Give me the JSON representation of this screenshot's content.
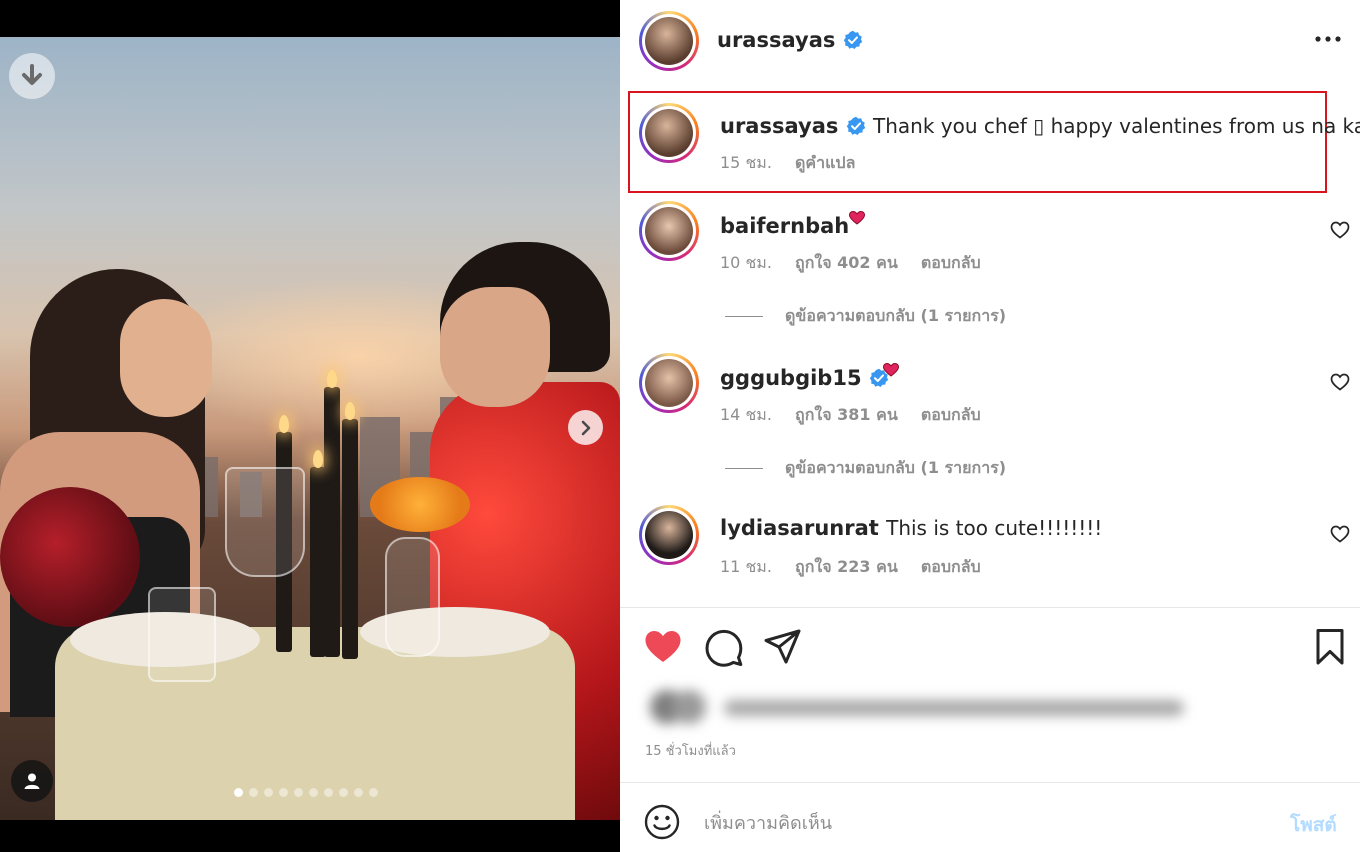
{
  "post": {
    "author": "urassayas",
    "carousel": {
      "total": 10,
      "active_index": 0
    }
  },
  "caption": {
    "username": "urassayas",
    "text": "Thank you chef ▯ happy valentines from us na ka!",
    "time": "15 ชม.",
    "translate": "ดูคำแปล"
  },
  "comments": [
    {
      "username": "baifernbah",
      "text": "",
      "emoji": "heart",
      "verified": false,
      "time": "10 ชม.",
      "likes": "ถูกใจ 402 คน",
      "reply": "ตอบกลับ",
      "view_replies": "ดูข้อความตอบกลับ (1 รายการ)"
    },
    {
      "username": "gggubgib15",
      "text": "",
      "emoji": "heart",
      "verified": true,
      "time": "14 ชม.",
      "likes": "ถูกใจ 381 คน",
      "reply": "ตอบกลับ",
      "view_replies": "ดูข้อความตอบกลับ (1 รายการ)"
    },
    {
      "username": "lydiasarunrat",
      "text": "This is too cute!!!!!!!!",
      "verified": false,
      "time": "11 ชม.",
      "likes": "ถูกใจ 223 คน",
      "reply": "ตอบกลับ"
    }
  ],
  "footer": {
    "time_ago": "15 ชั่วโมงที่แล้ว",
    "comment_placeholder": "เพิ่มความคิดเห็น",
    "post_label": "โพสต์"
  },
  "colors": {
    "liked_heart": "#ed4956",
    "verified": "#3897f0",
    "highlight_box": "#d8141e",
    "post_button": "#b3dbff"
  },
  "icons": [
    "download-icon",
    "chevron-right-icon",
    "user-tag-icon",
    "verified-badge-icon",
    "more-options-icon",
    "heart-icon",
    "comment-icon",
    "share-icon",
    "bookmark-icon",
    "emoji-icon"
  ]
}
